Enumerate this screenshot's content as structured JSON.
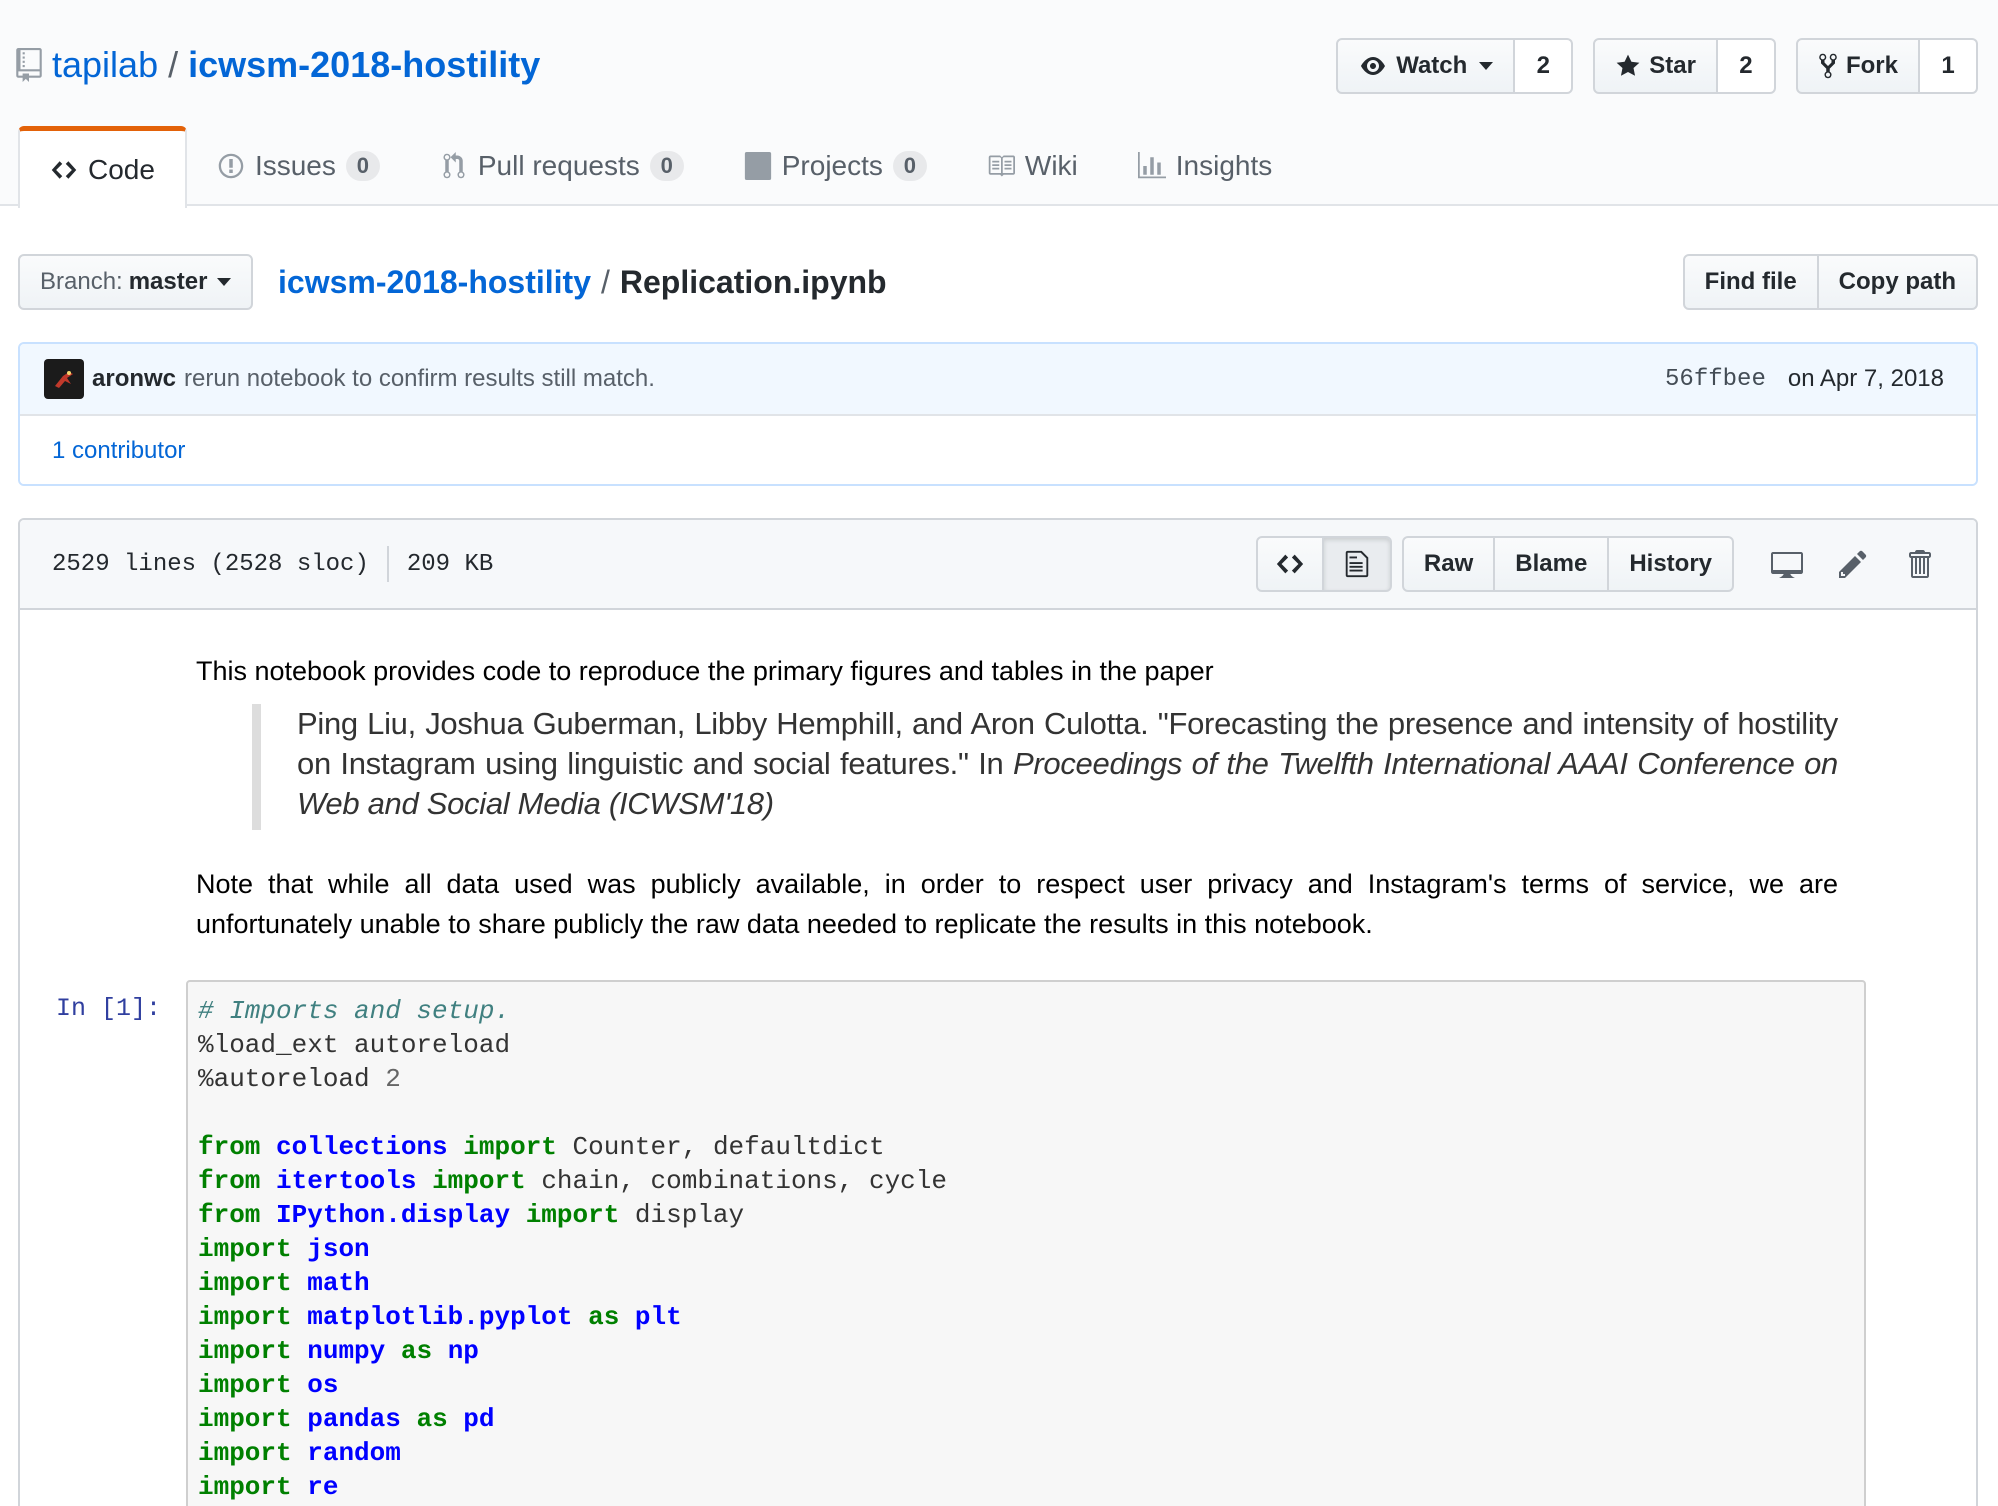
{
  "repo": {
    "owner": "tapilab",
    "separator": "/",
    "name": "icwsm-2018-hostility"
  },
  "actions": [
    {
      "label": "Watch",
      "count": "2",
      "icon": "eye-icon"
    },
    {
      "label": "Star",
      "count": "2",
      "icon": "star-icon"
    },
    {
      "label": "Fork",
      "count": "1",
      "icon": "fork-icon"
    }
  ],
  "tabs": [
    {
      "label": "Code",
      "icon": "code-icon",
      "selected": true
    },
    {
      "label": "Issues",
      "counter": "0",
      "icon": "issue-icon"
    },
    {
      "label": "Pull requests",
      "counter": "0",
      "icon": "pull-request-icon"
    },
    {
      "label": "Projects",
      "counter": "0",
      "icon": "project-icon"
    },
    {
      "label": "Wiki",
      "icon": "book-icon"
    },
    {
      "label": "Insights",
      "icon": "graph-icon"
    }
  ],
  "file_nav": {
    "branch_prefix": "Branch:",
    "branch": "master",
    "breadcrumb_repo": "icwsm-2018-hostility",
    "separator": "/",
    "file": "Replication.ipynb",
    "find_file": "Find file",
    "copy_path": "Copy path"
  },
  "commit": {
    "author": "aronwc",
    "message": "rerun notebook to confirm results still match.",
    "sha": "56ffbee",
    "date": "on Apr 7, 2018",
    "contributors": "1 contributor"
  },
  "file_header": {
    "lines": "2529 lines (2528 sloc)",
    "size": "209 KB",
    "raw": "Raw",
    "blame": "Blame",
    "history": "History"
  },
  "notebook": {
    "intro": "This notebook provides code to reproduce the primary figures and tables in the paper",
    "citation_plain": "Ping Liu, Joshua Guberman, Libby Hemphill, and Aron Culotta. \"Forecasting the presence and intensity of hostility on Instagram using linguistic and social features.\" In ",
    "citation_italic": "Proceedings of the Twelfth International AAAI Conference on Web and Social Media (ICWSM'18)",
    "note": "Note that while all data used was publicly available, in order to respect user privacy and Instagram's terms of service, we are unfortunately unable to share publicly the raw data needed to replicate the results in this notebook.",
    "cell_prompt": "In [1]:",
    "code": {
      "comment": "# Imports and setup.",
      "magic1": "%load_ext autoreload",
      "magic2_cmd": "%autoreload",
      "magic2_arg": "2",
      "lines": [
        {
          "kw1": "from",
          "mod": "collections",
          "kw2": "import",
          "rest": "Counter, defaultdict"
        },
        {
          "kw1": "from",
          "mod": "itertools",
          "kw2": "import",
          "rest": "chain, combinations, cycle"
        },
        {
          "kw1": "from",
          "mod": "IPython.display",
          "kw2": "import",
          "rest": "display"
        },
        {
          "kw1": "import",
          "mod": "json"
        },
        {
          "kw1": "import",
          "mod": "math"
        },
        {
          "kw1": "import",
          "mod": "matplotlib.pyplot",
          "kw2": "as",
          "alias": "plt"
        },
        {
          "kw1": "import",
          "mod": "numpy",
          "kw2": "as",
          "alias": "np"
        },
        {
          "kw1": "import",
          "mod": "os"
        },
        {
          "kw1": "import",
          "mod": "pandas",
          "kw2": "as",
          "alias": "pd"
        },
        {
          "kw1": "import",
          "mod": "random"
        },
        {
          "kw1": "import",
          "mod": "re"
        }
      ]
    }
  }
}
